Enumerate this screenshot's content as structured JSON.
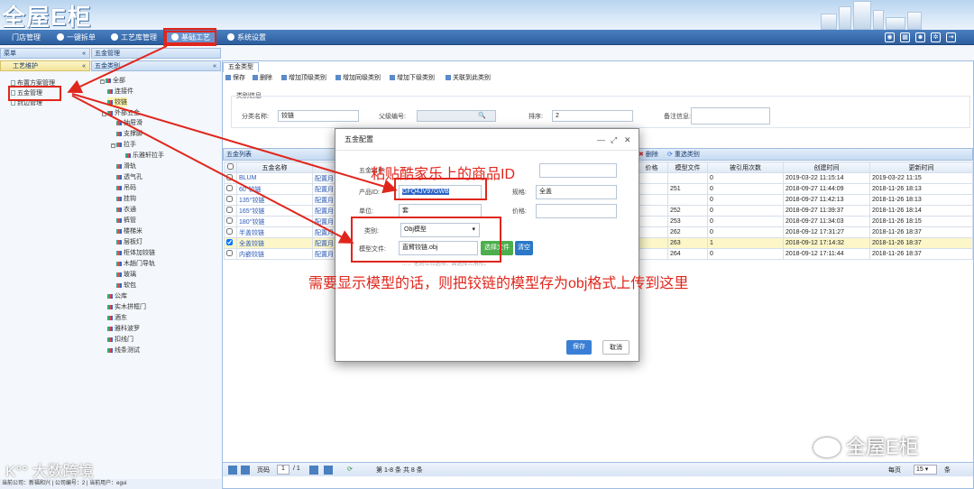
{
  "app": {
    "logo": "全屋E柜"
  },
  "menu": {
    "items": [
      "门店管理",
      "一键拆单",
      "工艺库管理",
      "基础工艺",
      "系统设置"
    ],
    "active_index": 3,
    "tools": [
      "camera-icon",
      "calendar-icon",
      "user-icon",
      "gear-icon",
      "logout-icon"
    ]
  },
  "left_panel": {
    "header": "菜单",
    "section": "工艺维护",
    "items": [
      "布置方案管理",
      "五金管理",
      "封边管理"
    ]
  },
  "category_panel": {
    "header": "五金管理",
    "sub": "五金类别",
    "tree": [
      "全部",
      "连接件",
      "铰链",
      "外部五金",
      "抽屉滑",
      "支撑脚",
      "拉手",
      "乐雅轩拉手",
      "滑轨",
      "透气孔",
      "吊码",
      "挂钩",
      "衣通",
      "裤管",
      "楼梯米",
      "层板灯",
      "柜体加铰链",
      "木趟门导轨",
      "玻璃",
      "软包",
      "公库",
      "实木拼框门",
      "酒东",
      "雅科波罗",
      "扣线门",
      "线条测试"
    ]
  },
  "tab": {
    "label": "五金类型"
  },
  "toolbar": {
    "items": [
      "保存",
      "删除",
      "增加顶级类别",
      "增加同级类别",
      "增加下级类别",
      "关联到此类别"
    ]
  },
  "category_info": {
    "title": "类别信息",
    "name_label": "分类名称:",
    "name_value": "铰链",
    "parent_label": "父级编号:",
    "order_label": "排序:",
    "order_value": "2",
    "remark_label": "备注信息:"
  },
  "list": {
    "title": "五金列表",
    "toolbar": [
      "删除",
      "重选类别"
    ],
    "columns": [
      "五金名称",
      "价格",
      "模型文件",
      "被引用次数",
      "创建时间",
      "更新时间"
    ],
    "rows": [
      {
        "name": "BLUM",
        "cfg": "配置月",
        "price": "",
        "model": "",
        "refs": "0",
        "created": "2019-03-22 11:15:14",
        "updated": "2019-03-22 11:15"
      },
      {
        "name": "60°铰链",
        "cfg": "配置月",
        "price": "",
        "model": "251",
        "refs": "0",
        "created": "2018-09-27 11:44:09",
        "updated": "2018-11-26 18:13"
      },
      {
        "name": "135°铰链",
        "cfg": "配置月",
        "price": "",
        "model": "",
        "refs": "0",
        "created": "2018-09-27 11:42:13",
        "updated": "2018-11-26 18:13"
      },
      {
        "name": "165°铰链",
        "cfg": "配置月",
        "price": "",
        "model": "252",
        "refs": "0",
        "created": "2018-09-27 11:39:37",
        "updated": "2018-11-26 18:14"
      },
      {
        "name": "180°铰链",
        "cfg": "配置月",
        "price": "",
        "model": "253",
        "refs": "0",
        "created": "2018-09-27 11:34:03",
        "updated": "2018-11-26 18:15"
      },
      {
        "name": "半盖铰链",
        "cfg": "配置月",
        "price": "",
        "model": "262",
        "refs": "0",
        "created": "2018-09-12 17:31:27",
        "updated": "2018-11-26 18:37"
      },
      {
        "name": "全盖铰链",
        "cfg": "配置月",
        "price": "",
        "model": "263",
        "refs": "1",
        "created": "2018-09-12 17:14:32",
        "updated": "2018-11-26 18:37"
      },
      {
        "name": "内嵌铰链",
        "cfg": "配置月",
        "price": "",
        "model": "264",
        "refs": "0",
        "created": "2018-09-12 17:11:44",
        "updated": "2018-11-26 18:37"
      }
    ]
  },
  "pager": {
    "page_label": "页码",
    "page": "1",
    "of": "/ 1",
    "info": "第 1-8 条  共 8 条",
    "per_label": "每页",
    "per": "15",
    "total_label": "条"
  },
  "modal": {
    "title": "五金配置",
    "label_name": "五金名称:",
    "label_product": "产品ID:",
    "product_value": "GFQ4JV97GWB",
    "label_spec": "规格:",
    "spec_value": "全盖",
    "label_unit": "单位:",
    "unit_value": "套",
    "label_price": "价格:",
    "label_type": "类别:",
    "type_value": "Obj模型",
    "label_file": "模型文件:",
    "file_value": "直臂铰链.obj",
    "choose_btn": "选择文件",
    "clear_btn": "清空",
    "hint": "... 、无则以铰选项，面选择三角形。",
    "save": "保存",
    "cancel": "取消"
  },
  "annotations": {
    "a1": "粘贴酷家乐上的商品ID",
    "a2": "需要显示模型的话，则把铰链的模型存为obj格式上传到这里"
  },
  "status": "当前公司：新福和兴 | 公司编号：2 | 当前用户：egui",
  "watermarks": {
    "left": "大数跨境",
    "right": "全屋E柜"
  },
  "colors": {
    "accent": "#2c5e9e",
    "annotation": "#e0261c",
    "save": "#3a7fd5",
    "choose": "#4cae4c"
  }
}
